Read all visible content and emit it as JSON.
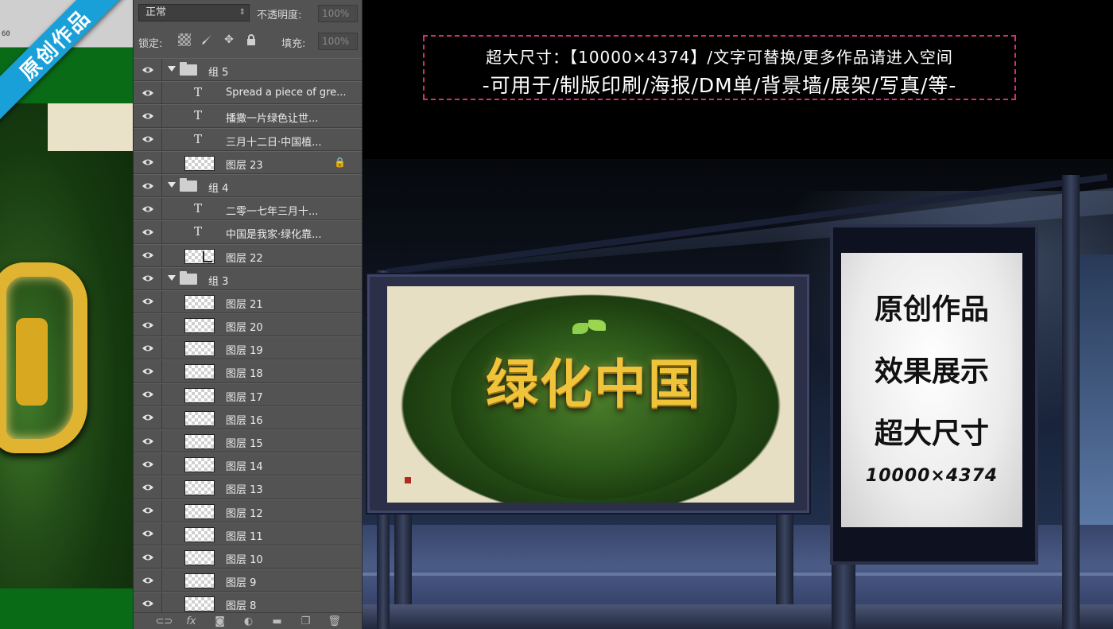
{
  "canvas": {
    "ruler_number": "60",
    "ribbon_text": "原创作品"
  },
  "layers_panel": {
    "blend_mode": "正常",
    "opacity_label": "不透明度:",
    "opacity_value": "100%",
    "lock_label": "锁定:",
    "fill_label": "填充:",
    "fill_value": "100%",
    "layers": [
      {
        "type": "group",
        "name": "组 5"
      },
      {
        "type": "text",
        "name": "Spread a piece of gre..."
      },
      {
        "type": "text",
        "name": "播撒一片绿色让世..."
      },
      {
        "type": "text",
        "name": "三月十二日·中国植..."
      },
      {
        "type": "pixel",
        "name": "图层 23",
        "locked": true
      },
      {
        "type": "group",
        "name": "组 4"
      },
      {
        "type": "text",
        "name": "二零一七年三月十..."
      },
      {
        "type": "text",
        "name": "中国是我家·绿化靠..."
      },
      {
        "type": "pixel-linked",
        "name": "图层 22"
      },
      {
        "type": "group",
        "name": "组 3"
      },
      {
        "type": "pixel",
        "name": "图层 21"
      },
      {
        "type": "pixel",
        "name": "图层 20"
      },
      {
        "type": "pixel",
        "name": "图层 19"
      },
      {
        "type": "pixel",
        "name": "图层 18"
      },
      {
        "type": "pixel",
        "name": "图层 17"
      },
      {
        "type": "pixel",
        "name": "图层 16"
      },
      {
        "type": "pixel",
        "name": "图层 15"
      },
      {
        "type": "pixel",
        "name": "图层 14"
      },
      {
        "type": "pixel",
        "name": "图层 13"
      },
      {
        "type": "pixel",
        "name": "图层 12"
      },
      {
        "type": "pixel",
        "name": "图层 11"
      },
      {
        "type": "pixel",
        "name": "图层 10"
      },
      {
        "type": "pixel",
        "name": "图层 9"
      },
      {
        "type": "pixel",
        "name": "图层 8"
      }
    ],
    "footer_icons": [
      "link-icon",
      "fx-icon",
      "mask-icon",
      "adjustment-icon",
      "folder-icon",
      "new-layer-icon",
      "trash-icon"
    ]
  },
  "banner": {
    "line1": "超大尺寸：【10000×4374】/文字可替换/更多作品请进入空间",
    "line2": "-可用于/制版印刷/海报/DM单/背景墙/展架/写真/等-"
  },
  "billboard": {
    "title": "绿化中国"
  },
  "lightbox": {
    "line1": "原创作品",
    "line2": "效果展示",
    "line3": "超大尺寸",
    "line4": "10000×4374"
  },
  "colors": {
    "panel_bg": "#535353",
    "ribbon": "#1aa0d8",
    "banner_border": "#d0307a",
    "gold": "#f0c43a",
    "canvas_green": "#0a6b17"
  }
}
